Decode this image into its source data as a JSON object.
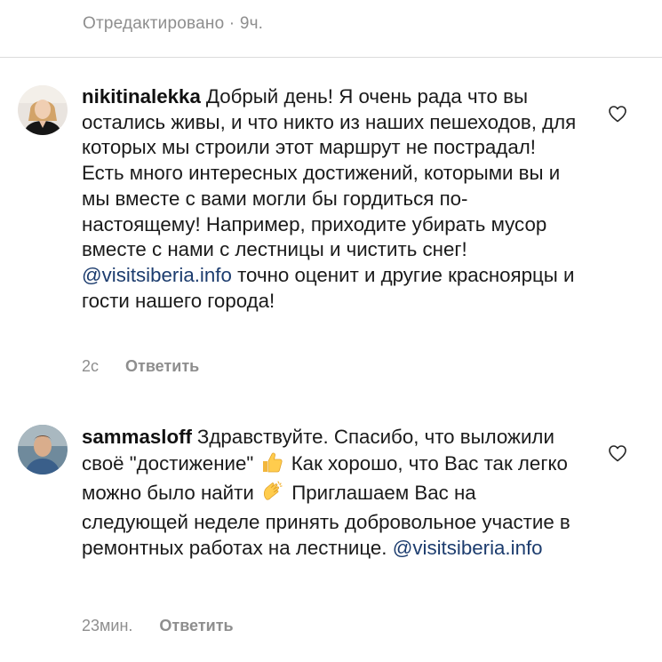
{
  "top_meta": "Отредактировано · 9ч.",
  "comments": [
    {
      "username": "nikitinalekka",
      "text_before_mention": "Добрый день! Я очень рада что вы остались живы, и что никто из наших пешеходов, для которых мы строили этот маршрут не пострадал! Есть много интересных достижений, которыми вы и мы вместе с вами могли бы гордиться по-настоящему! Например, приходите убирать мусор вместе с нами с лестницы и чистить снег!",
      "mention": "@visitsiberia.info",
      "text_after_mention": "точно оценит и другие красноярцы и гости нашего города!",
      "time": "2c",
      "reply_label": "Ответить"
    },
    {
      "username": "sammasloff",
      "text_part1": "Здравствуйте. Спасибо, что выложили своё \"достижение\"",
      "emoji1": "thumbs-up-emoji",
      "text_part2": "Как хорошо, что Вас так легко можно было найти",
      "emoji2": "clapping-hands-emoji",
      "text_part3": "Приглашаем Вас на следующей неделе принять добровольное участие в ремонтных работах на лестнице.",
      "mention": "@visitsiberia.info",
      "time": "23мин.",
      "reply_label": "Ответить"
    }
  ],
  "icons": {
    "like": "heart-outline-icon"
  },
  "colors": {
    "mention": "#1c3c6e",
    "meta": "#8e8e8e",
    "divider": "#dbdbdb"
  }
}
